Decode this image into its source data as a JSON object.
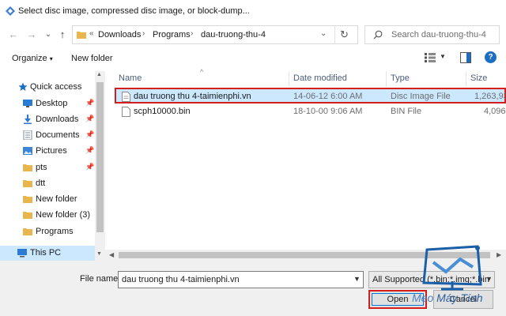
{
  "window": {
    "title": "Select disc image, compressed disc image, or block-dump..."
  },
  "nav": {
    "back_glyph": "←",
    "forward_glyph": "→",
    "recent_glyph": "⌄",
    "up_glyph": "↑",
    "crumb_prefix": "«",
    "breadcrumb": [
      "Downloads",
      "Programs",
      "dau-truong-thu-4"
    ],
    "search_placeholder": "Search dau-truong-thu-4"
  },
  "toolbar": {
    "organize_label": "Organize",
    "new_folder_label": "New folder"
  },
  "sidebar": {
    "items": [
      {
        "label": "Quick access",
        "icon": "star-icon"
      },
      {
        "label": "Desktop",
        "icon": "desktop-icon",
        "pinned": true
      },
      {
        "label": "Downloads",
        "icon": "download-icon",
        "pinned": true
      },
      {
        "label": "Documents",
        "icon": "documents-icon",
        "pinned": true
      },
      {
        "label": "Pictures",
        "icon": "pictures-icon",
        "pinned": true
      },
      {
        "label": "pts",
        "icon": "folder-icon",
        "pinned": true
      },
      {
        "label": "dtt",
        "icon": "folder-icon"
      },
      {
        "label": "New folder",
        "icon": "folder-icon"
      },
      {
        "label": "New folder (3)",
        "icon": "folder-icon"
      },
      {
        "label": "Programs",
        "icon": "folder-icon"
      },
      {
        "label": "This PC",
        "icon": "pc-icon",
        "selected": true
      }
    ]
  },
  "filelist": {
    "columns": [
      "Name",
      "Date modified",
      "Type",
      "Size"
    ],
    "rows": [
      {
        "name": "dau truong thu 4-taimienphi.vn",
        "date": "14-06-12 6:00 AM",
        "type": "Disc Image File",
        "size": "1,263,93",
        "selected": true
      },
      {
        "name": "scph10000.bin",
        "date": "18-10-00 9:06 AM",
        "type": "BIN File",
        "size": "4,096"
      }
    ]
  },
  "bottom": {
    "filename_label": "File name:",
    "filename_value": "dau truong thu 4-taimienphi.vn",
    "filetype_value": "All Supported (*.bin;*.img;*.bin",
    "open_label": "Open",
    "cancel_label": "Cancel"
  },
  "watermark": {
    "text_a": "Meo ",
    "text_b": "Máy Tính"
  },
  "colors": {
    "accent": "#0078d7",
    "selection": "#cce8ff",
    "highlight_border": "#d31e1e",
    "folder": "#e8b64c"
  }
}
